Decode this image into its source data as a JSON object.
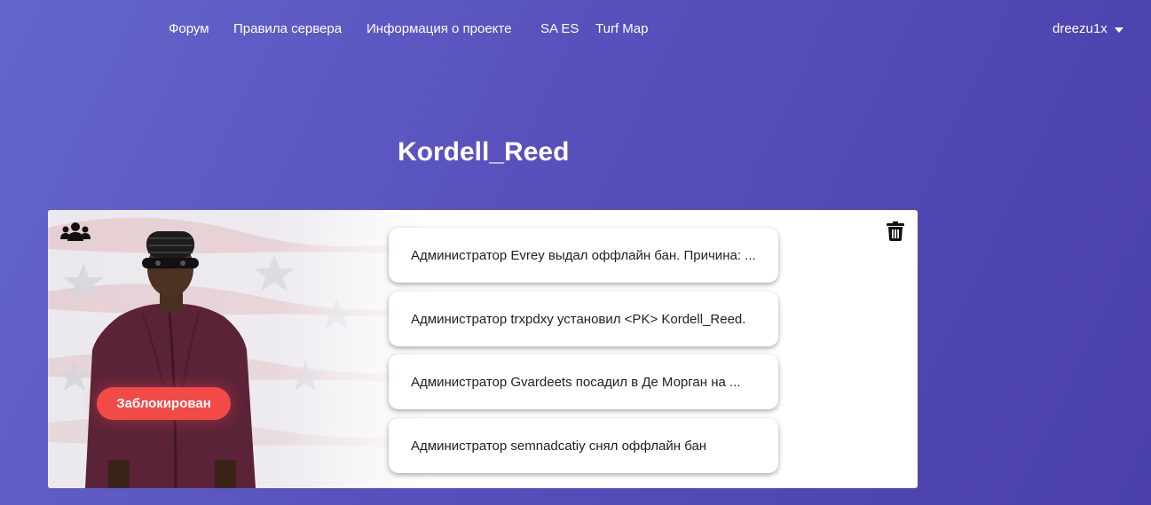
{
  "nav": {
    "links": [
      {
        "label": "Форум"
      },
      {
        "label": "Правила сервера"
      },
      {
        "label": "Информация о проекте"
      },
      {
        "label": "SA ES"
      },
      {
        "label": "Turf Map"
      }
    ],
    "user": {
      "name": "dreezu1x",
      "icon": "caret-down-icon"
    }
  },
  "page": {
    "title": "Kordell_Reed"
  },
  "profile": {
    "status": "Заблокирован",
    "status_color": "#f14a47",
    "icons": {
      "left": "users-icon",
      "right": "trash-icon"
    }
  },
  "logs": [
    {
      "text": "Администратор Evrey выдал оффлайн бан. Причина: ..."
    },
    {
      "text": "Администратор trxpdxy установил <PK> Kordell_Reed."
    },
    {
      "text": "Администратор Gvardeets посадил в Де Морган на ..."
    },
    {
      "text": "Администратор semnadcatiy снял оффлайн бан"
    }
  ]
}
